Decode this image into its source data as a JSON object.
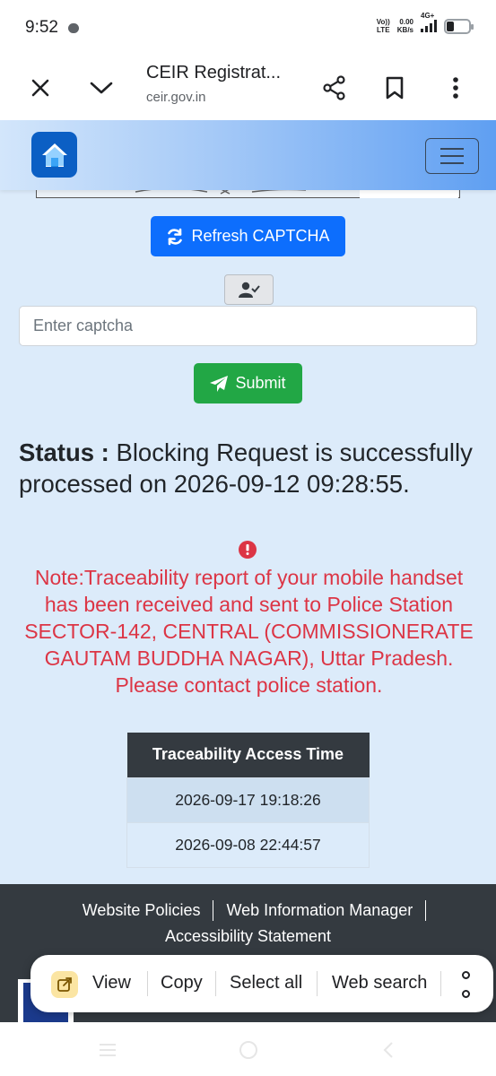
{
  "status_bar": {
    "time": "9:52",
    "network_volte_top": "Vo))",
    "network_volte_bottom": "LTE",
    "speed_top": "0.00",
    "speed_bottom": "KB/s",
    "network_type": "4G+"
  },
  "browser": {
    "title": "CEIR Registrat...",
    "url": "ceir.gov.in",
    "icons": [
      "close-icon",
      "chevron-down-icon",
      "share-icon",
      "bookmark-icon",
      "more-vert-icon"
    ]
  },
  "site": {
    "refresh_label": "Refresh CAPTCHA",
    "captcha_placeholder": "Enter captcha",
    "submit_label": "Submit",
    "status_label": "Status :",
    "status_message": " Blocking Request is successfully processed on 2026-09-12 09:28:55.",
    "note": "Note:Traceability report of your mobile handset has been received and sent to Police Station SECTOR-142, CENTRAL (COMMISSIONERATE GAUTAM BUDDHA NAGAR), Uttar Pradesh. Please contact police station.",
    "table": {
      "header": "Traceability Access Time",
      "rows": [
        "2026-09-17 19:18:26",
        "2026-09-08 22:44:57"
      ]
    },
    "colors": {
      "primary": "#0d6efd",
      "success": "#22a745",
      "danger": "#dc3545",
      "page_bg": "#dcebfa",
      "footer_bg": "#343a40"
    }
  },
  "footer": {
    "links": [
      "Website Policies",
      "Web Information Manager",
      "Accessibility Statement"
    ]
  },
  "context_menu": {
    "items": [
      "View",
      "Copy",
      "Select all",
      "Web search"
    ]
  }
}
